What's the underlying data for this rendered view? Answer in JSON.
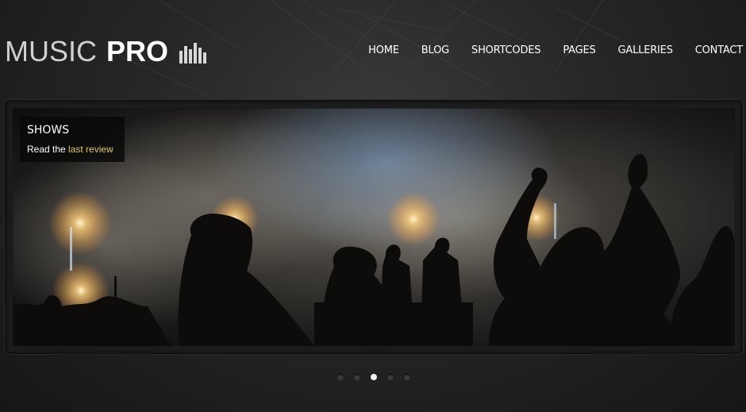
{
  "site": {
    "logo_light": "MUSIC",
    "logo_bold": "PRO",
    "logo_icon": "equalizer-bars-icon"
  },
  "nav": {
    "items": [
      {
        "label": "HOME"
      },
      {
        "label": "BLOG"
      },
      {
        "label": "SHORTCODES"
      },
      {
        "label": "PAGES"
      },
      {
        "label": "GALLERIES"
      },
      {
        "label": "CONTACT"
      }
    ]
  },
  "slider": {
    "caption_title": "SHOWS",
    "caption_prefix": "Read the ",
    "caption_link": "last review",
    "pagination": {
      "count": 5,
      "active": 3
    }
  },
  "colors": {
    "caption_link": "#e3c84a",
    "background": "#262626",
    "nav_text": "#ffffff"
  }
}
